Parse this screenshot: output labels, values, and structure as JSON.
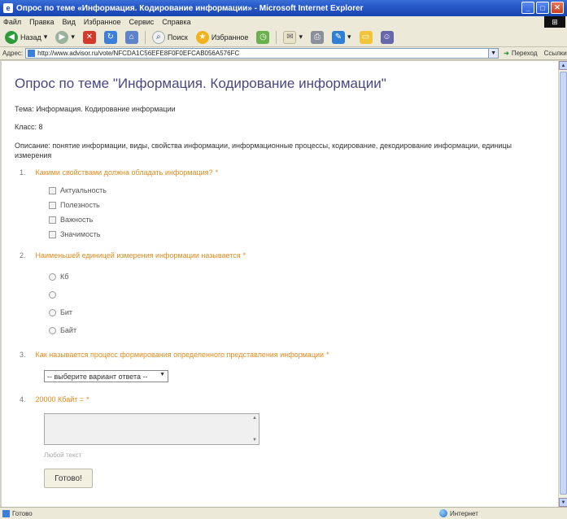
{
  "window": {
    "title": "Опрос по теме «Информация. Кодирование информации» - Microsoft Internet Explorer",
    "controls": {
      "minimize": "_",
      "maximize": "□",
      "close": "✕"
    }
  },
  "menu": [
    "Файл",
    "Правка",
    "Вид",
    "Избранное",
    "Сервис",
    "Справка"
  ],
  "toolbar": {
    "back_label": "Назад",
    "search_label": "Поиск",
    "favorites_label": "Избранное"
  },
  "address": {
    "label": "Адрес:",
    "url": "http://www.advisor.ru/vote/NFCDA1C56EFE8F0F0EFCAB056A576FC",
    "go_label": "Переход",
    "links_label": "Ссылки"
  },
  "page": {
    "title": "Опрос по теме \"Информация. Кодирование информации\"",
    "theme": "Тема: Информация. Кодирование информации",
    "grade": "Класс: 8",
    "description": "Описание: понятие информации, виды, свойства информации, информационные процессы, кодирование, декодирование информации, единицы измерения"
  },
  "questions": [
    {
      "number": "1.",
      "text": "Какими свойствами должна обладать информация?",
      "required": "*",
      "type": "checkbox",
      "options": [
        "Актуальность",
        "Полезность",
        "Важность",
        "Значимость"
      ]
    },
    {
      "number": "2.",
      "text": "Наименьшей единицей измерения информации называется",
      "required": "*",
      "type": "radio",
      "options": [
        "Кб",
        "",
        "Бит",
        "Байт"
      ]
    },
    {
      "number": "3.",
      "text": "Как называется процесс формирования определенного представления информации",
      "required": "*",
      "type": "select",
      "selected": "-- выберите вариант ответа --"
    },
    {
      "number": "4.",
      "text": "20000 Кбайт = ",
      "required": "*",
      "type": "text",
      "hint": "Любой текст"
    }
  ],
  "submit_label": "Готово!",
  "status": {
    "left": "Готово",
    "zone": "Интернет"
  }
}
